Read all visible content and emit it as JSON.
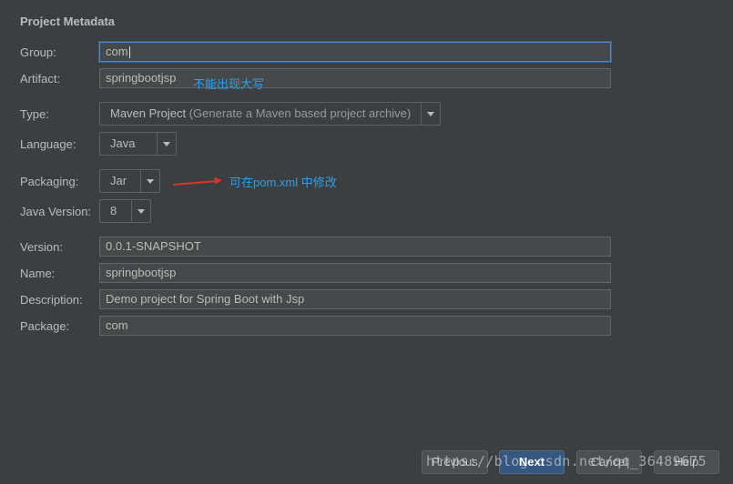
{
  "section": {
    "title": "Project Metadata"
  },
  "form": {
    "group_label": "Group:",
    "group_value": "com",
    "artifact_label": "Artifact:",
    "artifact_value": "springbootjsp",
    "artifact_note": "不能出现大写",
    "type_label": "Type:",
    "type_value": "Maven Project",
    "type_hint": "(Generate a Maven based project archive)",
    "language_label": "Language:",
    "language_value": "Java",
    "packaging_label": "Packaging:",
    "packaging_value": "Jar",
    "packaging_note": "可在pom.xml 中修改",
    "java_version_label": "Java Version:",
    "java_version_value": "8",
    "version_label": "Version:",
    "version_value": "0.0.1-SNAPSHOT",
    "name_label": "Name:",
    "name_value": "springbootjsp",
    "description_label": "Description:",
    "description_value": "Demo project for Spring Boot with Jsp",
    "package_label": "Package:",
    "package_value": "com"
  },
  "buttons": {
    "previous": "Previous",
    "next": "Next",
    "cancel": "Cancel",
    "help": "Help"
  },
  "watermark": "https://blog.csdn.net/qq_36489675",
  "colors": {
    "background": "#3c3f41",
    "annotation": "#2f9ee8",
    "arrow": "#d9342b",
    "focus_border": "#4a88c7",
    "primary_button": "#365880"
  },
  "icons": {
    "combo_arrow": "chevron-down-icon",
    "annotation_arrow": "red-arrow-icon"
  }
}
